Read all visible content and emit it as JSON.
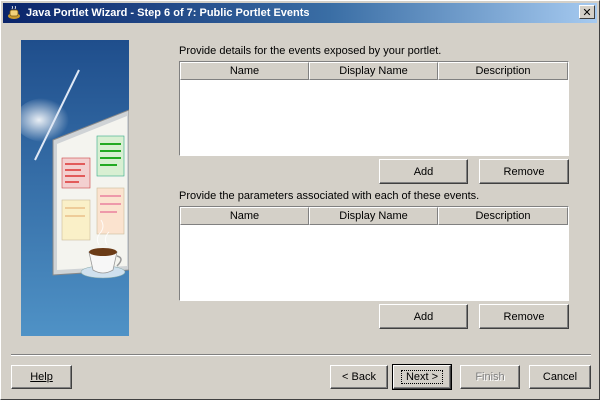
{
  "window": {
    "title": "Java Portlet Wizard - Step 6 of 7: Public Portlet Events",
    "close_label": "✕",
    "icons": [
      "app-icon",
      "close-icon"
    ]
  },
  "events_section": {
    "label": "Provide details for the events exposed by your portlet.",
    "columns": [
      "Name",
      "Display Name",
      "Description"
    ],
    "add_label": "Add",
    "remove_label": "Remove"
  },
  "params_section": {
    "label": "Provide the parameters associated with each of these events.",
    "columns": [
      "Name",
      "Display Name",
      "Description"
    ],
    "add_label": "Add",
    "remove_label": "Remove"
  },
  "footer": {
    "help_label": "Help",
    "back_label": "< Back",
    "next_label": "Next >",
    "finish_label": "Finish",
    "cancel_label": "Cancel"
  },
  "colors": {
    "title_start": "#0a246a",
    "title_end": "#a6caf0",
    "graphic_top": "#1f4e8c",
    "graphic_bottom": "#4f92c6"
  }
}
